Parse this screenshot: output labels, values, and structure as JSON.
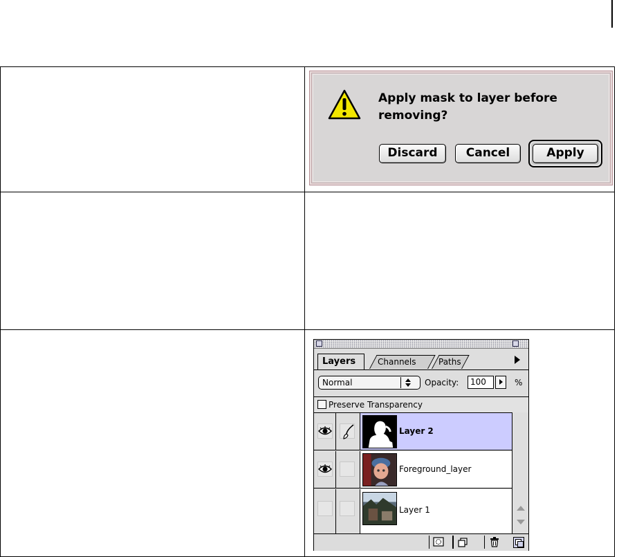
{
  "alert": {
    "message": "Apply mask to layer before removing?",
    "buttons": {
      "discard": "Discard",
      "cancel": "Cancel",
      "apply": "Apply"
    },
    "icon": "warning-icon",
    "accent_color": "#f2e600"
  },
  "layers_palette": {
    "tabs": [
      "Layers",
      "Channels",
      "Paths"
    ],
    "active_tab": "Layers",
    "blend_mode": "Normal",
    "opacity_label": "Opacity:",
    "opacity_value": "100",
    "opacity_unit": "%",
    "preserve_transparency_label": "Preserve Transparency",
    "preserve_transparency_checked": false,
    "selected_color": "#ccccff",
    "layers": [
      {
        "name": "Layer 2",
        "visible": true,
        "has_mask": true,
        "selected": true,
        "bold": true
      },
      {
        "name": "Foreground_layer",
        "visible": true,
        "has_mask": false,
        "selected": false,
        "bold": false
      },
      {
        "name": "Layer 1",
        "visible": false,
        "has_mask": false,
        "selected": false,
        "bold": false
      }
    ],
    "bottom_icons": [
      "mask-icon",
      "new-layer-icon",
      "trash-icon"
    ]
  }
}
